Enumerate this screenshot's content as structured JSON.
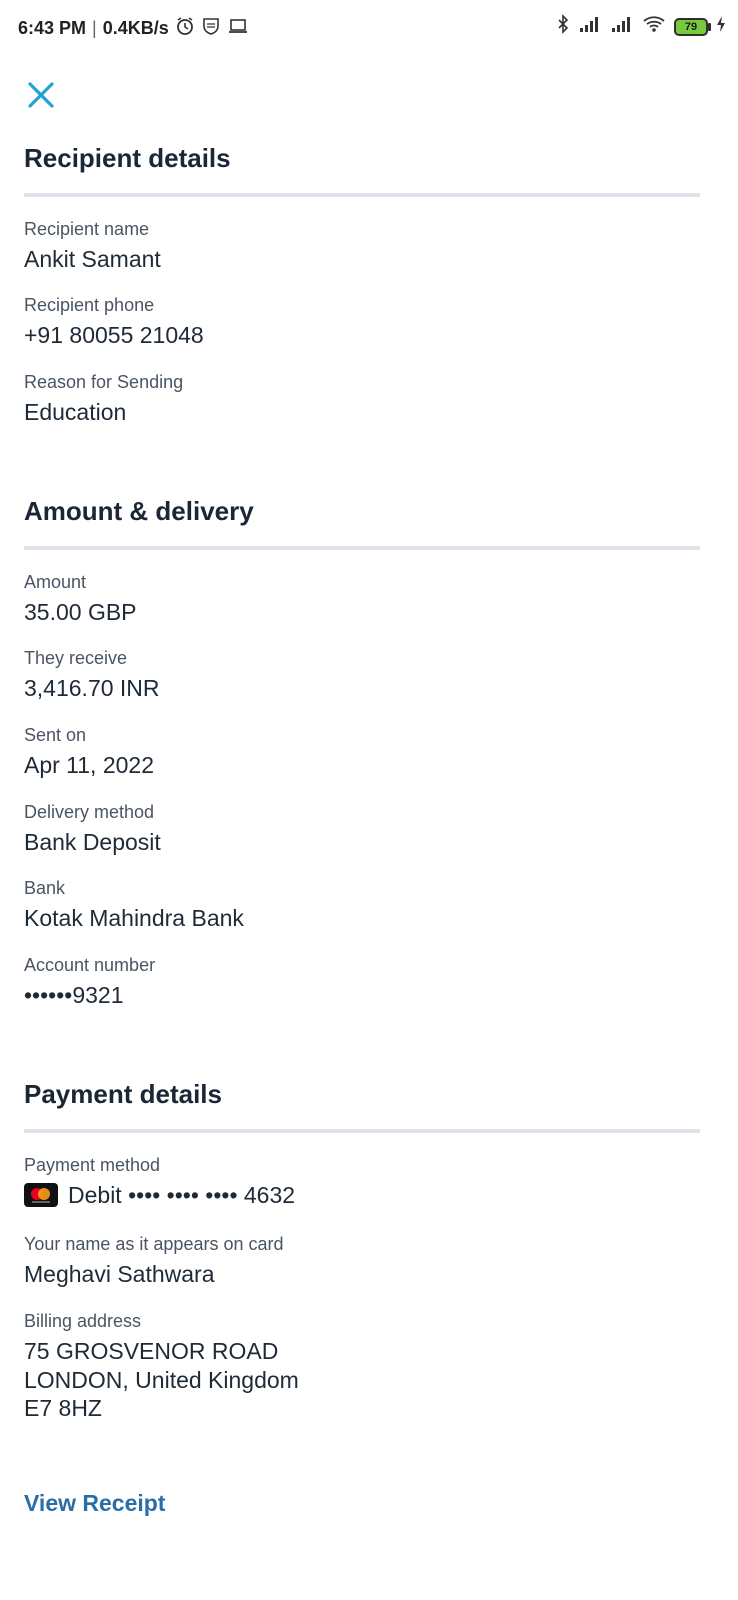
{
  "status_bar": {
    "time": "6:43 PM",
    "separator": "|",
    "speed": "0.4KB/s",
    "battery": "79",
    "icons": [
      "alarm-icon",
      "shield-icon",
      "laptop-icon",
      "bluetooth-icon",
      "signal-icon",
      "signal-icon",
      "wifi-icon",
      "battery-icon",
      "charging-icon"
    ]
  },
  "close_icon": "close-icon",
  "accent_color": "#1ea2d8",
  "link_color": "#2a6ea8",
  "recipient": {
    "title": "Recipient details",
    "name_label": "Recipient name",
    "name_value": "Ankit Samant",
    "phone_label": "Recipient phone",
    "phone_value": "+91 80055 21048",
    "reason_label": "Reason for Sending",
    "reason_value": "Education"
  },
  "amount": {
    "title": "Amount & delivery",
    "amount_label": "Amount",
    "amount_value": "35.00 GBP",
    "receive_label": "They receive",
    "receive_value": "3,416.70 INR",
    "sent_label": "Sent on",
    "sent_value": "Apr 11, 2022",
    "delivery_label": "Delivery method",
    "delivery_value": "Bank Deposit",
    "bank_label": "Bank",
    "bank_value": "Kotak Mahindra Bank",
    "account_label": "Account number",
    "account_value": "••••••9321"
  },
  "payment": {
    "title": "Payment details",
    "method_label": "Payment method",
    "card_icon": "mastercard-icon",
    "method_value": "Debit •••• •••• •••• 4632",
    "cardname_label": "Your name as it appears on card",
    "cardname_value": "Meghavi Sathwara",
    "address_label": "Billing address",
    "address_line1": "75 GROSVENOR ROAD",
    "address_line2": "LONDON, United Kingdom",
    "address_line3": "E7 8HZ"
  },
  "actions": {
    "view_receipt": "View Receipt"
  }
}
